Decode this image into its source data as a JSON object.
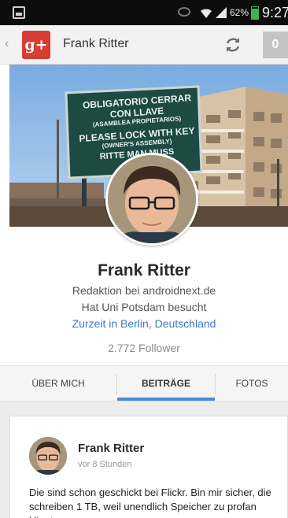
{
  "status_bar": {
    "battery_percent": "62%",
    "time": "9:27",
    "icons": [
      "screenshot-icon",
      "eye-icon",
      "wifi-icon",
      "signal-icon",
      "battery-icon"
    ]
  },
  "action_bar": {
    "logo_text": "g+",
    "title": "Frank Ritter",
    "notification_count": "0",
    "icons": [
      "back-chevron-icon",
      "refresh-icon"
    ]
  },
  "cover": {
    "sign_lines": [
      "OBLIGATORIO CERRAR",
      "CON LLAVE",
      "(ASAMBLEA PROPIETARIOS)",
      "PLEASE LOCK WITH KEY",
      "(OWNER'S ASSEMBLY)",
      "RITTE MAN MUSS"
    ]
  },
  "profile": {
    "name": "Frank Ritter",
    "occupation": "Redaktion bei androidnext.de",
    "education": "Hat Uni Potsdam besucht",
    "location": "Zurzeit in Berlin, Deutschland",
    "followers": "2.772 Follower"
  },
  "tabs": [
    {
      "label": "ÜBER MICH"
    },
    {
      "label": "BEITRÄGE"
    },
    {
      "label": "FOTOS"
    }
  ],
  "post": {
    "author": "Frank Ritter",
    "time": "vor 8 Stunden",
    "text": "Die sind schon geschickt bei Flickr. Bin mir sicher, die schreiben 1 TB, weil unendlich Speicher zu profan klingt."
  },
  "colors": {
    "accent": "#4b8ad6",
    "brand_red": "#d73d32",
    "link": "#3d78c6",
    "battery_green": "#3ab54a"
  }
}
